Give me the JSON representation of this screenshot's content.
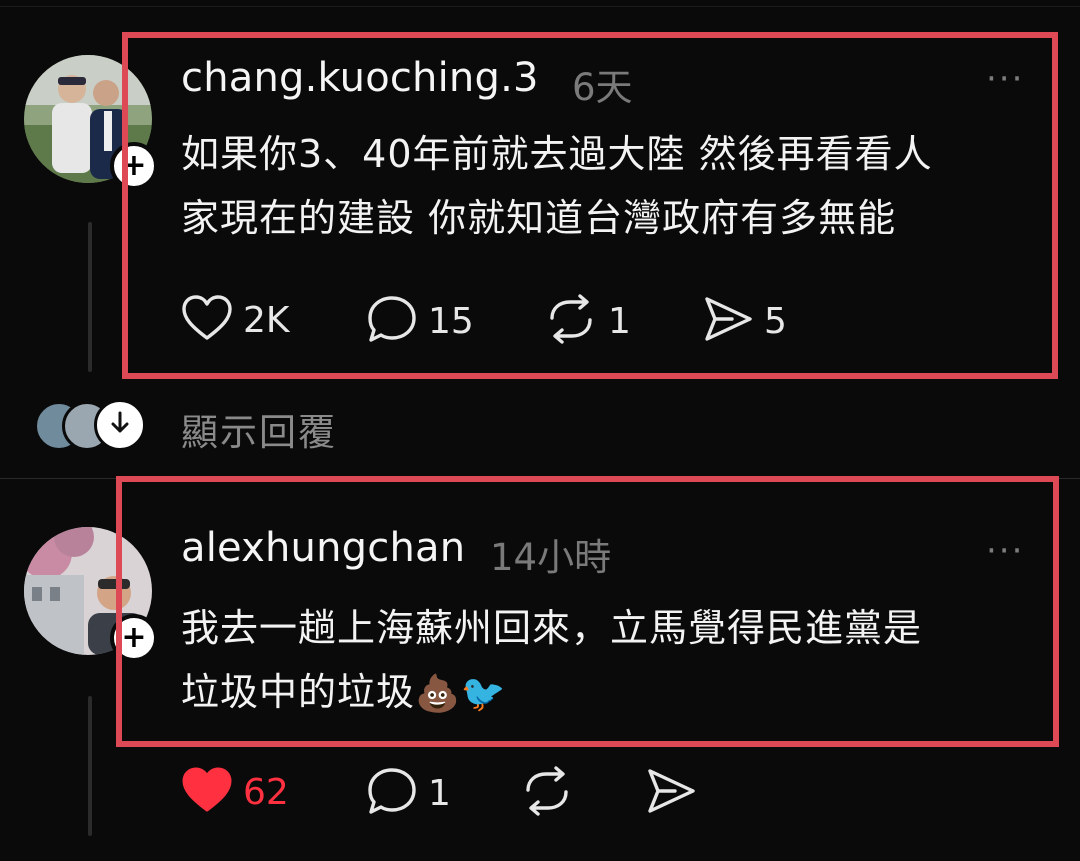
{
  "posts": [
    {
      "username": "chang.kuoching.3",
      "time": "6天",
      "more": "···",
      "follow_symbol": "+",
      "text_lines": [
        "如果你3、40年前就去過大陸 然後再看看人",
        "家現在的建設 你就知道台灣政府有多無能"
      ],
      "actions": {
        "likes": "2K",
        "comments": "15",
        "reposts": "1",
        "shares": "5"
      },
      "liked": false
    },
    {
      "username": "alexhungchan",
      "time": "14小時",
      "more": "···",
      "follow_symbol": "+",
      "text_lines": [
        "我去一趟上海蘇州回來，立馬覺得民進黨是",
        "垃圾中的垃圾"
      ],
      "emojis": [
        "💩",
        "🐦"
      ],
      "actions": {
        "likes": "62",
        "comments": "1",
        "reposts": "",
        "shares": ""
      },
      "liked": true
    }
  ],
  "show_replies": {
    "label": "顯示回覆"
  },
  "icons": {
    "heart": "heart-icon",
    "comment": "comment-icon",
    "repost": "repost-icon",
    "share": "share-icon",
    "down": "arrow-down-icon",
    "more": "more-icon"
  },
  "colors": {
    "background": "#0a0a0a",
    "highlight": "#dd4a55",
    "like_active": "#ff3040",
    "muted": "#7a7a7a"
  }
}
